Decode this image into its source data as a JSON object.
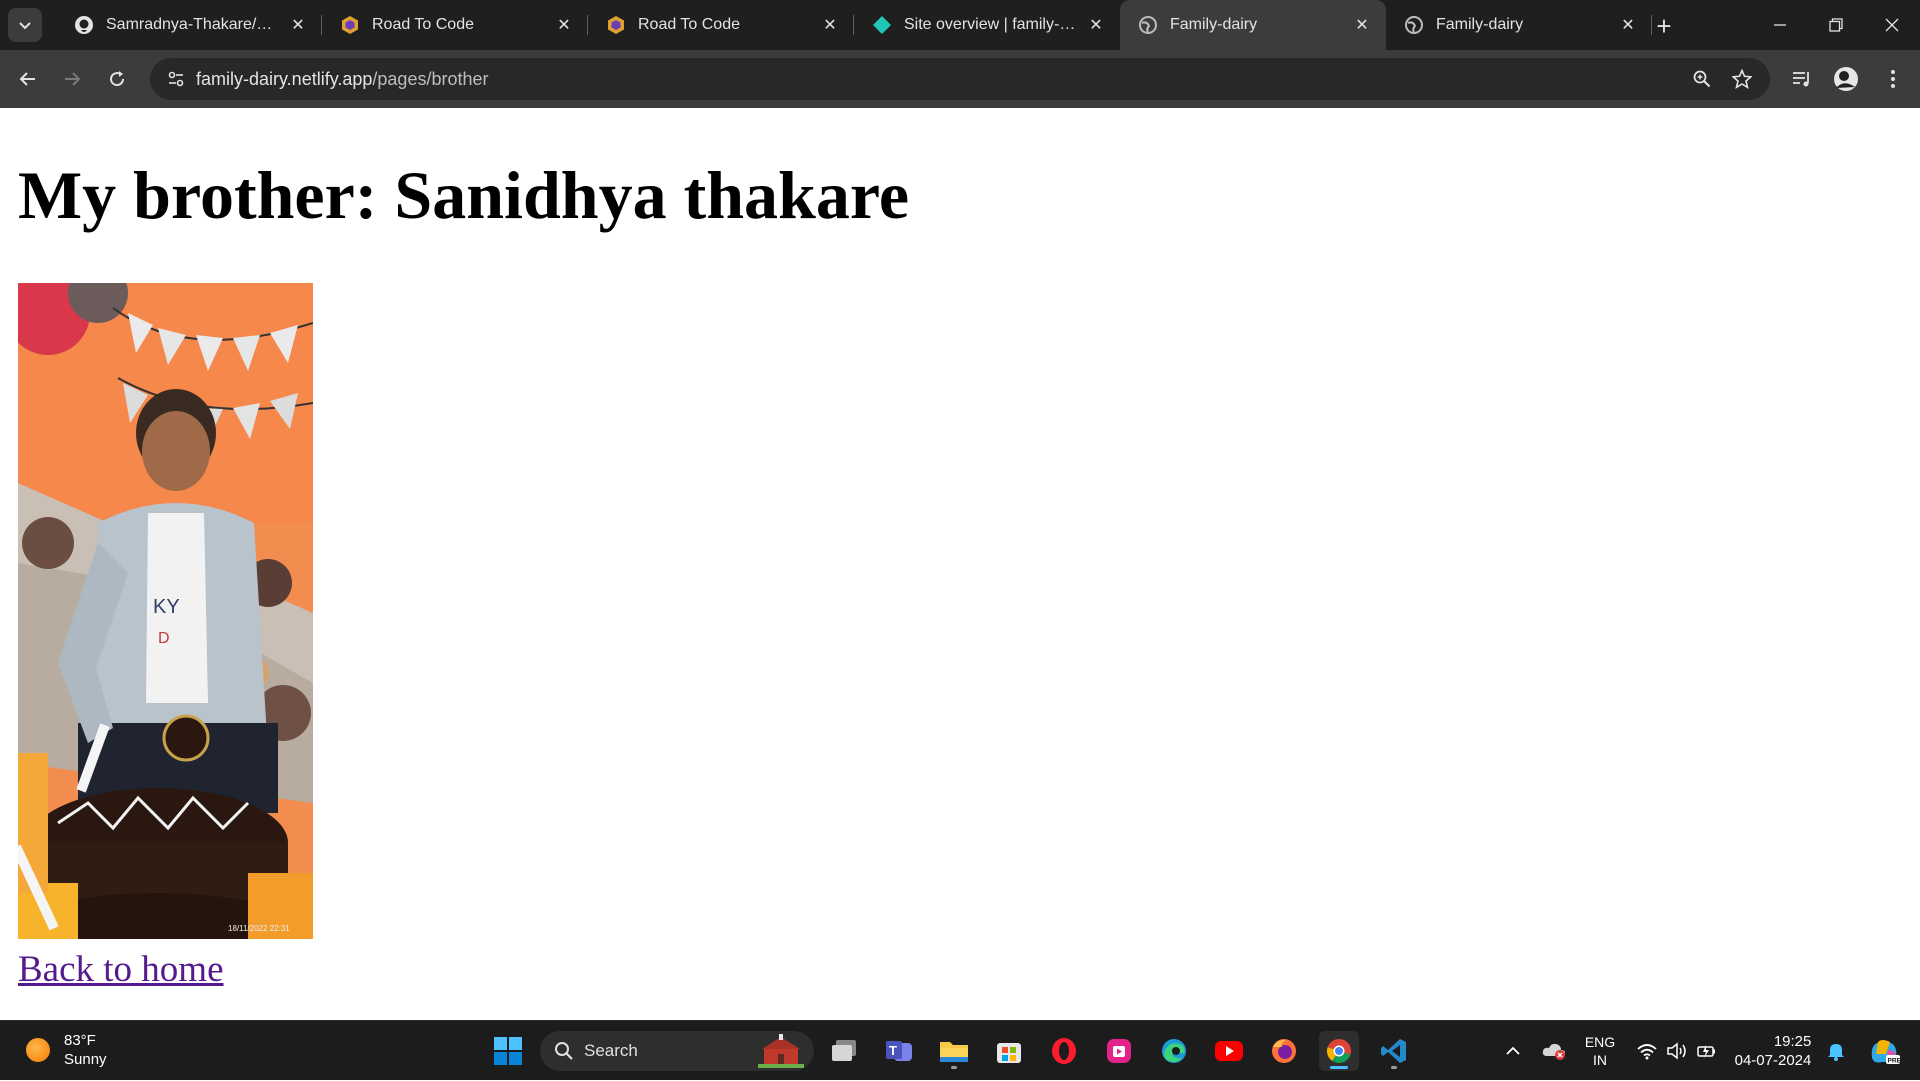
{
  "browser": {
    "tabs": [
      {
        "title": "Samradnya-Thakare/Family",
        "favicon": "github-icon",
        "active": false
      },
      {
        "title": "Road To Code",
        "favicon": "road-to-code-icon",
        "active": false
      },
      {
        "title": "Road To Code",
        "favicon": "road-to-code-icon",
        "active": false
      },
      {
        "title": "Site overview | family-dairy",
        "favicon": "netlify-icon",
        "active": false
      },
      {
        "title": "Family-dairy",
        "favicon": "globe-icon",
        "active": true
      },
      {
        "title": "Family-dairy",
        "favicon": "globe-icon",
        "active": false
      }
    ],
    "address": {
      "host": "family-dairy.netlify.app",
      "path": "/pages/brother"
    },
    "accent": "#3c3c3c"
  },
  "page": {
    "heading": "My brother: Sanidhya thakare",
    "photo_timestamp": "18/11/2022 22:31",
    "back_link": "Back to home",
    "link_color": "#551a8b"
  },
  "taskbar": {
    "weather": {
      "temp": "83°F",
      "condition": "Sunny"
    },
    "search_label": "Search",
    "apps": [
      "start-icon",
      "search-icon",
      "task-view-icon",
      "teams-icon",
      "file-explorer-icon",
      "store-icon",
      "opera-icon",
      "clipchamp-icon",
      "edge-icon",
      "youtube-icon",
      "firefox-icon",
      "chrome-icon",
      "vscode-icon"
    ],
    "language": {
      "line1": "ENG",
      "line2": "IN"
    },
    "clock": {
      "time": "19:25",
      "date": "04-07-2024"
    }
  }
}
